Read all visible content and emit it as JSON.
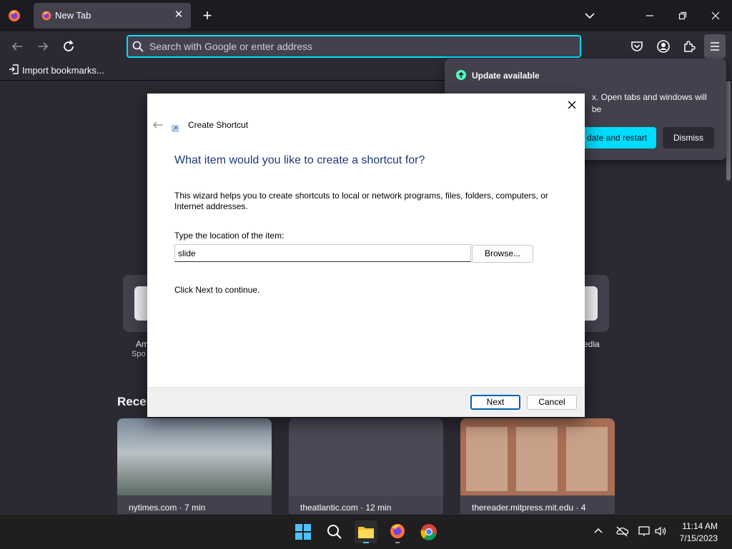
{
  "browser": {
    "tab": {
      "title": "New Tab"
    },
    "urlbar": {
      "placeholder": "Search with Google or enter address"
    },
    "bookmarks": {
      "import_label": "Import bookmarks..."
    }
  },
  "new_tab": {
    "top_sites": [
      {
        "label_partial": "Am",
        "sublabel_partial": "Spo"
      },
      {
        "label_partial": "edia"
      }
    ],
    "recent_heading_partial": "Recen",
    "recent_cards": [
      {
        "source": "nytimes.com · 7 min"
      },
      {
        "source": "theatlantic.com · 12 min"
      },
      {
        "source": "thereader.mitpress.mit.edu · 4"
      }
    ]
  },
  "update_panel": {
    "title": "Update available",
    "body_visible": "x. Open tabs and windows will be",
    "restart_label": "date and restart",
    "dismiss_label": "Dismiss",
    "accent_color": "#00ddff"
  },
  "wizard": {
    "title": "Create Shortcut",
    "heading": "What item would you like to create a shortcut for?",
    "description": "This wizard helps you to create shortcuts to local or network programs, files, folders, computers, or Internet addresses.",
    "location_label": "Type the location of the item:",
    "location_value": "slide",
    "browse_label": "Browse...",
    "continue_text": "Click Next to continue.",
    "next_label": "Next",
    "cancel_label": "Cancel",
    "heading_color": "#1b3a7a"
  },
  "taskbar": {
    "time": "11:14 AM",
    "date": "7/15/2023"
  }
}
